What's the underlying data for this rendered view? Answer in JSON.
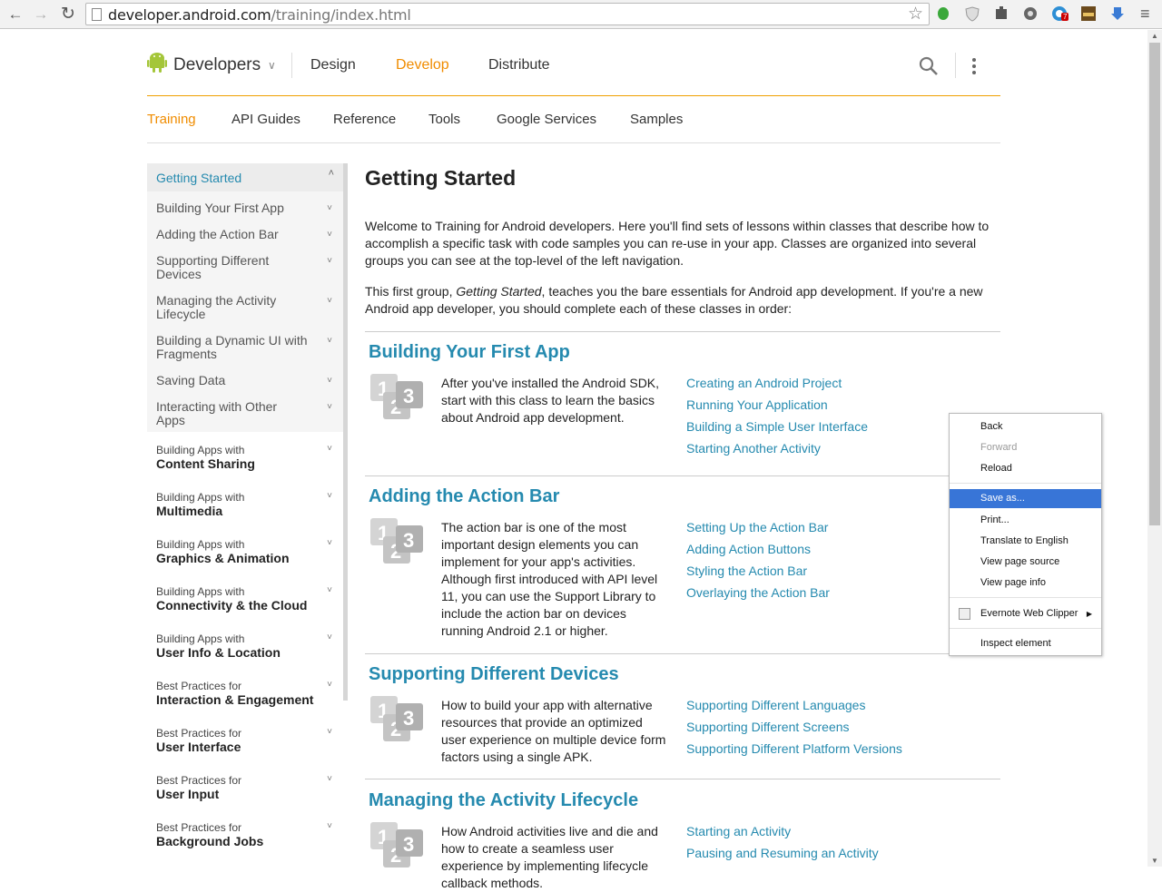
{
  "browser": {
    "url_host": "developer.android.com",
    "url_path": "/training/index.html",
    "back_glyph": "←",
    "forward_glyph": "→",
    "reload_glyph": "↻",
    "star_glyph": "☆",
    "menu_glyph": "≡",
    "extension_icons": [
      "evernote-icon",
      "shield-icon",
      "puzzle-icon",
      "gear-icon",
      "globe-icon",
      "app-icon",
      "download-icon"
    ],
    "extension_badge": "7"
  },
  "header": {
    "brand": "Developers",
    "chevron": "∨",
    "nav": [
      "Design",
      "Develop",
      "Distribute"
    ],
    "active_nav": "Develop",
    "accent_color": "#f08c00"
  },
  "sub_nav": {
    "tabs": [
      "Training",
      "API Guides",
      "Reference",
      "Tools",
      "Google Services",
      "Samples"
    ],
    "active": "Training"
  },
  "left_nav": {
    "header": "Getting Started",
    "header_caret": "˄",
    "caret": "˅",
    "sub_items": [
      "Building Your First App",
      "Adding the Action Bar",
      "Supporting Different Devices",
      "Managing the Activity Lifecycle",
      "Building a Dynamic UI with Fragments",
      "Saving Data",
      "Interacting with Other Apps"
    ],
    "groups": [
      {
        "small": "Building Apps with",
        "big": "Content Sharing"
      },
      {
        "small": "Building Apps with",
        "big": "Multimedia"
      },
      {
        "small": "Building Apps with",
        "big": "Graphics & Animation"
      },
      {
        "small": "Building Apps with",
        "big": "Connectivity & the Cloud"
      },
      {
        "small": "Building Apps with",
        "big": "User Info & Location"
      },
      {
        "small": "Best Practices for",
        "big": "Interaction & Engagement"
      },
      {
        "small": "Best Practices for",
        "big": "User Interface"
      },
      {
        "small": "Best Practices for",
        "big": "User Input"
      },
      {
        "small": "Best Practices for",
        "big": "Background Jobs"
      }
    ]
  },
  "main": {
    "title": "Getting Started",
    "intro1": "Welcome to Training for Android developers. Here you'll find sets of lessons within classes that describe how to accomplish a specific task with code samples you can re-use in your app. Classes are organized into several groups you can see at the top-level of the left navigation.",
    "intro2_a": "This first group, ",
    "intro2_em": "Getting Started",
    "intro2_b": ", teaches you the bare essentials for Android app development. If you're a new Android app developer, you should complete each of these classes in order:",
    "icon_digits": [
      "1",
      "2",
      "3"
    ],
    "sections": [
      {
        "title": "Building Your First App",
        "desc": "After you've installed the Android SDK, start with this class to learn the basics about Android app development.",
        "links": [
          "Creating an Android Project",
          "Running Your Application",
          "Building a Simple User Interface",
          "Starting Another Activity"
        ]
      },
      {
        "title": "Adding the Action Bar",
        "desc": "The action bar is one of the most important design elements you can implement for your app's activities. Although first introduced with API level 11, you can use the Support Library to include the action bar on devices running Android 2.1 or higher.",
        "links": [
          "Setting Up the Action Bar",
          "Adding Action Buttons",
          "Styling the Action Bar",
          "Overlaying the Action Bar"
        ]
      },
      {
        "title": "Supporting Different Devices",
        "desc": "How to build your app with alternative resources that provide an optimized user experience on multiple device form factors using a single APK.",
        "links": [
          "Supporting Different Languages",
          "Supporting Different Screens",
          "Supporting Different Platform Versions"
        ]
      },
      {
        "title": "Managing the Activity Lifecycle",
        "desc": "How Android activities live and die and how to create a seamless user experience by implementing lifecycle callback methods.",
        "links": [
          "Starting an Activity",
          "Pausing and Resuming an Activity"
        ]
      }
    ]
  },
  "context_menu": {
    "items": [
      {
        "label": "Back",
        "state": "normal"
      },
      {
        "label": "Forward",
        "state": "disabled"
      },
      {
        "label": "Reload",
        "state": "normal"
      },
      {
        "label": "Save as...",
        "state": "selected"
      },
      {
        "label": "Print...",
        "state": "normal"
      },
      {
        "label": "Translate to English",
        "state": "normal"
      },
      {
        "label": "View page source",
        "state": "normal"
      },
      {
        "label": "View page info",
        "state": "normal"
      },
      {
        "label": "Evernote Web Clipper",
        "state": "normal"
      },
      {
        "label": "Inspect element",
        "state": "normal"
      }
    ],
    "submenu_arrow": "▶",
    "selected_color": "#3875d7"
  },
  "colors": {
    "link": "#258aaf",
    "accent": "#f08c00",
    "android_green": "#a4c639"
  }
}
